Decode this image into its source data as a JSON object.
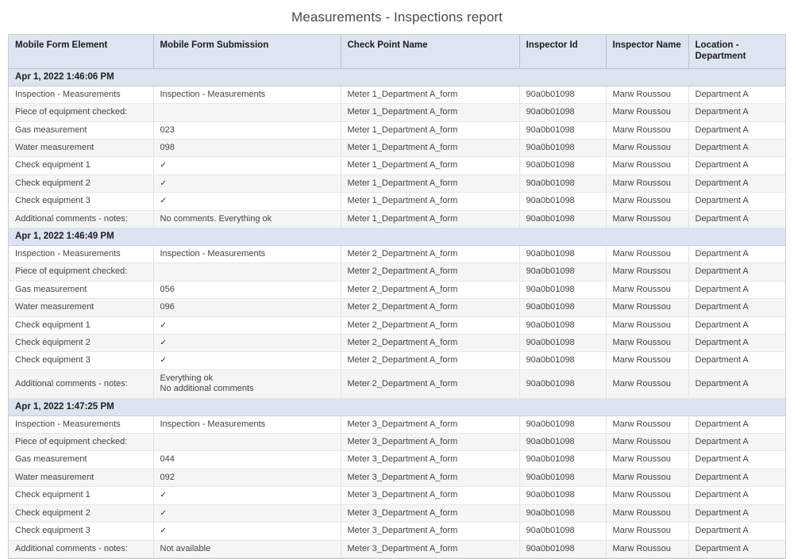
{
  "report": {
    "title": "Measurements - Inspections report",
    "columns": [
      "Mobile Form Element",
      "Mobile Form Submission",
      "Check Point Name",
      "Inspector Id",
      "Inspector Name",
      "Location - Department"
    ],
    "colors": {
      "header_bg": "#dde5f0",
      "group_bg": "#dbe4f0",
      "row_alt_bg": "#f5f5f5",
      "border": "#c9cdd3",
      "text": "#444444",
      "title_text": "#4a4a4a"
    },
    "check_glyph": "✓",
    "groups": [
      {
        "timestamp": "Apr 1, 2022 1:46:06 PM",
        "rows": [
          {
            "element": "Inspection - Measurements",
            "submission": "Inspection - Measurements",
            "check_point": "Meter 1_Department A_form",
            "inspector_id": "90a0b01098",
            "inspector_name": "Marw Roussou",
            "location": "Department A"
          },
          {
            "element": "Piece of equipment checked:",
            "submission": "",
            "check_point": "Meter 1_Department A_form",
            "inspector_id": "90a0b01098",
            "inspector_name": "Marw Roussou",
            "location": "Department A"
          },
          {
            "element": "Gas measurement",
            "submission": "023",
            "check_point": "Meter 1_Department A_form",
            "inspector_id": "90a0b01098",
            "inspector_name": "Marw Roussou",
            "location": "Department A"
          },
          {
            "element": "Water measurement",
            "submission": "098",
            "check_point": "Meter 1_Department A_form",
            "inspector_id": "90a0b01098",
            "inspector_name": "Marw Roussou",
            "location": "Department A"
          },
          {
            "element": "Check equipment 1",
            "submission": "✓",
            "check_point": "Meter 1_Department A_form",
            "inspector_id": "90a0b01098",
            "inspector_name": "Marw Roussou",
            "location": "Department A"
          },
          {
            "element": "Check equipment 2",
            "submission": "✓",
            "check_point": "Meter 1_Department A_form",
            "inspector_id": "90a0b01098",
            "inspector_name": "Marw Roussou",
            "location": "Department A"
          },
          {
            "element": "Check equipment 3",
            "submission": "✓",
            "check_point": "Meter 1_Department A_form",
            "inspector_id": "90a0b01098",
            "inspector_name": "Marw Roussou",
            "location": "Department A"
          },
          {
            "element": "Additional comments - notes:",
            "submission": "No comments. Everything ok",
            "check_point": "Meter 1_Department A_form",
            "inspector_id": "90a0b01098",
            "inspector_name": "Marw Roussou",
            "location": "Department A"
          }
        ]
      },
      {
        "timestamp": "Apr 1, 2022 1:46:49 PM",
        "rows": [
          {
            "element": "Inspection - Measurements",
            "submission": "Inspection - Measurements",
            "check_point": "Meter 2_Department A_form",
            "inspector_id": "90a0b01098",
            "inspector_name": "Marw Roussou",
            "location": "Department A"
          },
          {
            "element": "Piece of equipment checked:",
            "submission": "",
            "check_point": "Meter 2_Department A_form",
            "inspector_id": "90a0b01098",
            "inspector_name": "Marw Roussou",
            "location": "Department A"
          },
          {
            "element": "Gas measurement",
            "submission": "056",
            "check_point": "Meter 2_Department A_form",
            "inspector_id": "90a0b01098",
            "inspector_name": "Marw Roussou",
            "location": "Department A"
          },
          {
            "element": "Water measurement",
            "submission": "096",
            "check_point": "Meter 2_Department A_form",
            "inspector_id": "90a0b01098",
            "inspector_name": "Marw Roussou",
            "location": "Department A"
          },
          {
            "element": "Check equipment 1",
            "submission": "✓",
            "check_point": "Meter 2_Department A_form",
            "inspector_id": "90a0b01098",
            "inspector_name": "Marw Roussou",
            "location": "Department A"
          },
          {
            "element": "Check equipment 2",
            "submission": "✓",
            "check_point": "Meter 2_Department A_form",
            "inspector_id": "90a0b01098",
            "inspector_name": "Marw Roussou",
            "location": "Department A"
          },
          {
            "element": "Check equipment 3",
            "submission": "✓",
            "check_point": "Meter 2_Department A_form",
            "inspector_id": "90a0b01098",
            "inspector_name": "Marw Roussou",
            "location": "Department A"
          },
          {
            "element": "Additional comments - notes:",
            "submission": "Everything ok\nNo additional comments",
            "check_point": "Meter 2_Department A_form",
            "inspector_id": "90a0b01098",
            "inspector_name": "Marw Roussou",
            "location": "Department A"
          }
        ]
      },
      {
        "timestamp": "Apr 1, 2022 1:47:25 PM",
        "rows": [
          {
            "element": "Inspection - Measurements",
            "submission": "Inspection - Measurements",
            "check_point": "Meter 3_Department A_form",
            "inspector_id": "90a0b01098",
            "inspector_name": "Marw Roussou",
            "location": "Department A"
          },
          {
            "element": "Piece of equipment checked:",
            "submission": "",
            "check_point": "Meter 3_Department A_form",
            "inspector_id": "90a0b01098",
            "inspector_name": "Marw Roussou",
            "location": "Department A"
          },
          {
            "element": "Gas measurement",
            "submission": "044",
            "check_point": "Meter 3_Department A_form",
            "inspector_id": "90a0b01098",
            "inspector_name": "Marw Roussou",
            "location": "Department A"
          },
          {
            "element": "Water measurement",
            "submission": "092",
            "check_point": "Meter 3_Department A_form",
            "inspector_id": "90a0b01098",
            "inspector_name": "Marw Roussou",
            "location": "Department A"
          },
          {
            "element": "Check equipment 1",
            "submission": "✓",
            "check_point": "Meter 3_Department A_form",
            "inspector_id": "90a0b01098",
            "inspector_name": "Marw Roussou",
            "location": "Department A"
          },
          {
            "element": "Check equipment 2",
            "submission": "✓",
            "check_point": "Meter 3_Department A_form",
            "inspector_id": "90a0b01098",
            "inspector_name": "Marw Roussou",
            "location": "Department A"
          },
          {
            "element": "Check equipment 3",
            "submission": "✓",
            "check_point": "Meter 3_Department A_form",
            "inspector_id": "90a0b01098",
            "inspector_name": "Marw Roussou",
            "location": "Department A"
          },
          {
            "element": "Additional comments - notes:",
            "submission": "Not available",
            "check_point": "Meter 3_Department A_form",
            "inspector_id": "90a0b01098",
            "inspector_name": "Marw Roussou",
            "location": "Department A"
          }
        ]
      }
    ]
  }
}
